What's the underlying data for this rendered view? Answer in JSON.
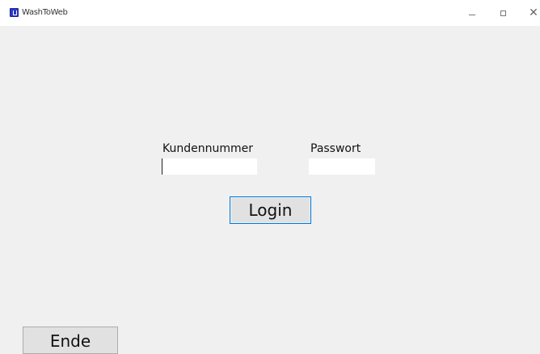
{
  "window": {
    "title": "WashToWeb",
    "icon": "app-icon",
    "controls": {
      "minimize": "minimize-icon",
      "maximize": "maximize-icon",
      "close": "close-icon"
    }
  },
  "form": {
    "customer_number_label": "Kundennummer",
    "customer_number_value": "",
    "password_label": "Passwort",
    "password_value": "",
    "login_label": "Login"
  },
  "footer": {
    "exit_label": "Ende"
  },
  "colors": {
    "background": "#f0f0f0",
    "titlebar": "#ffffff",
    "focus_border": "#0078d7",
    "button_face": "#e1e1e1"
  }
}
